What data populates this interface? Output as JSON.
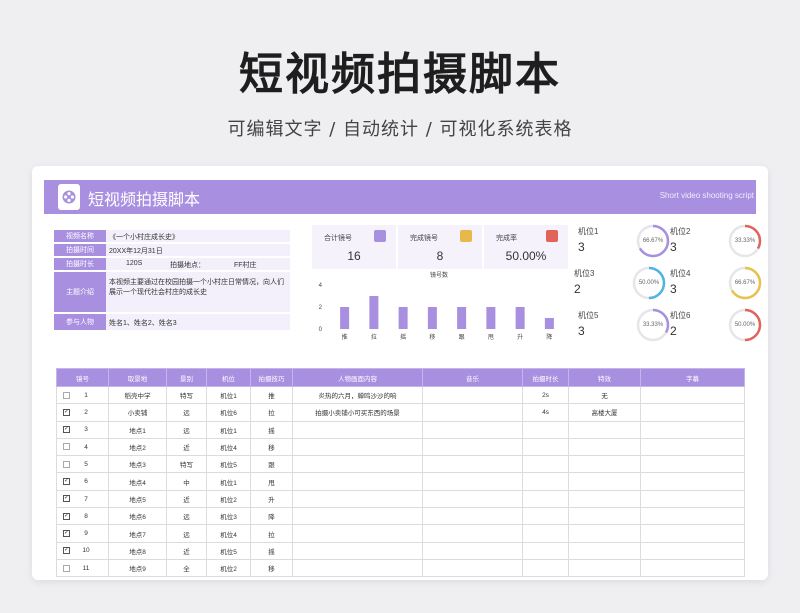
{
  "hero": {
    "title": "短视频拍摄脚本",
    "subtitle": "可编辑文字 / 自动统计 / 可视化系统表格"
  },
  "banner": {
    "title": "短视频拍摄脚本",
    "subtitle": "Short video shooting script",
    "logo_icon": "film-reel-icon",
    "color": "#a88fe0"
  },
  "info": {
    "video_name_key": "视频名称",
    "video_name": "《一个小村庄成长史》",
    "shoot_time_key": "拍摄时间",
    "shoot_time": "20XX年12月31日",
    "duration_key": "拍摄时长",
    "duration": "120S",
    "location_key": "拍摄地点：",
    "location": "FF村庄",
    "intro_key": "主题介绍",
    "intro": "本视频主要通过在校园拍摄一个小村庄日常情况，向人们展示一个现代社会村庄的成长史",
    "people_key": "参与人物",
    "people": "姓名1、姓名2、姓名3"
  },
  "stats": {
    "total_label": "合计镜号",
    "total_value": "16",
    "done_label": "完成镜号",
    "done_value": "8",
    "rate_label": "完成率",
    "rate_value": "50.00%"
  },
  "chart_data": {
    "type": "bar",
    "title": "镜号数",
    "categories": [
      "推",
      "拉",
      "摇",
      "移",
      "跟",
      "甩",
      "升",
      "降"
    ],
    "values": [
      2,
      3,
      2,
      2,
      2,
      2,
      2,
      1
    ],
    "ylim": [
      0,
      4
    ],
    "yticks": [
      "0",
      "2",
      "4"
    ],
    "color": "#a88fe0"
  },
  "gauges": [
    {
      "label": "机位1",
      "value": "3",
      "pct": "66.67%",
      "ratio": 0.6667,
      "color": "#a88fe0"
    },
    {
      "label": "机位2",
      "value": "3",
      "pct": "33.33%",
      "ratio": 0.3333,
      "color": "#e0645a"
    },
    {
      "label": "机位3",
      "value": "2",
      "pct": "50.00%",
      "ratio": 0.5,
      "color": "#4fb4df"
    },
    {
      "label": "机位4",
      "value": "3",
      "pct": "66.67%",
      "ratio": 0.6667,
      "color": "#e8c24a"
    },
    {
      "label": "机位5",
      "value": "3",
      "pct": "33.33%",
      "ratio": 0.3333,
      "color": "#a88fe0"
    },
    {
      "label": "机位6",
      "value": "2",
      "pct": "50.00%",
      "ratio": 0.5,
      "color": "#e0645a"
    }
  ],
  "table": {
    "headers": [
      "镜号",
      "取景地",
      "景别",
      "机位",
      "拍摄技巧",
      "人物画面内容",
      "音乐",
      "拍摄时长",
      "特效",
      "字幕"
    ],
    "rows": [
      {
        "done": false,
        "no": "1",
        "place": "稻壳中学",
        "scale": "特写",
        "cam": "机位1",
        "tech": "推",
        "content": "炎热的六月，蝉鸣沙沙的响",
        "music": "",
        "dur": "2s",
        "fx": "无",
        "sub": ""
      },
      {
        "done": true,
        "no": "2",
        "place": "小卖铺",
        "scale": "远",
        "cam": "机位6",
        "tech": "拉",
        "content": "拍摄小卖铺小可买东西的场景",
        "music": "",
        "dur": "4s",
        "fx": "高楼大厦",
        "sub": ""
      },
      {
        "done": true,
        "no": "3",
        "place": "地点1",
        "scale": "远",
        "cam": "机位1",
        "tech": "摇",
        "content": "",
        "music": "",
        "dur": "",
        "fx": "",
        "sub": ""
      },
      {
        "done": false,
        "no": "4",
        "place": "地点2",
        "scale": "近",
        "cam": "机位4",
        "tech": "移",
        "content": "",
        "music": "",
        "dur": "",
        "fx": "",
        "sub": ""
      },
      {
        "done": false,
        "no": "5",
        "place": "地点3",
        "scale": "特写",
        "cam": "机位5",
        "tech": "跟",
        "content": "",
        "music": "",
        "dur": "",
        "fx": "",
        "sub": ""
      },
      {
        "done": true,
        "no": "6",
        "place": "地点4",
        "scale": "中",
        "cam": "机位1",
        "tech": "甩",
        "content": "",
        "music": "",
        "dur": "",
        "fx": "",
        "sub": ""
      },
      {
        "done": true,
        "no": "7",
        "place": "地点5",
        "scale": "近",
        "cam": "机位2",
        "tech": "升",
        "content": "",
        "music": "",
        "dur": "",
        "fx": "",
        "sub": ""
      },
      {
        "done": true,
        "no": "8",
        "place": "地点6",
        "scale": "远",
        "cam": "机位3",
        "tech": "降",
        "content": "",
        "music": "",
        "dur": "",
        "fx": "",
        "sub": ""
      },
      {
        "done": true,
        "no": "9",
        "place": "地点7",
        "scale": "远",
        "cam": "机位4",
        "tech": "拉",
        "content": "",
        "music": "",
        "dur": "",
        "fx": "",
        "sub": ""
      },
      {
        "done": true,
        "no": "10",
        "place": "地点8",
        "scale": "近",
        "cam": "机位5",
        "tech": "摇",
        "content": "",
        "music": "",
        "dur": "",
        "fx": "",
        "sub": ""
      },
      {
        "done": false,
        "no": "11",
        "place": "地点9",
        "scale": "全",
        "cam": "机位2",
        "tech": "移",
        "content": "",
        "music": "",
        "dur": "",
        "fx": "",
        "sub": ""
      }
    ]
  }
}
